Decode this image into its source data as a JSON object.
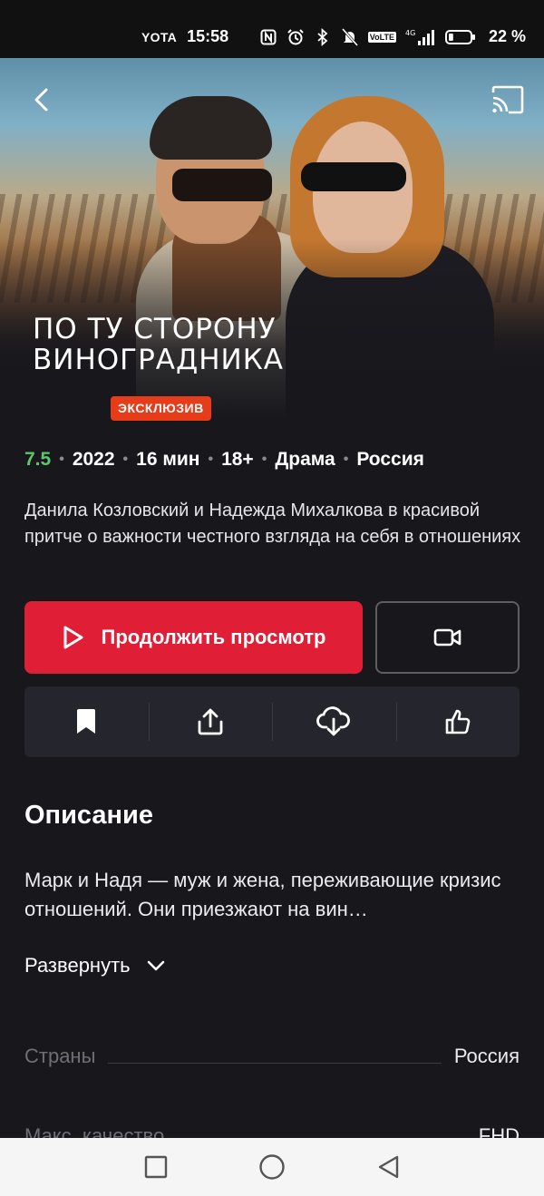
{
  "status_bar": {
    "carrier": "YOTA",
    "time": "15:58",
    "network_badge": "VoLTE",
    "signal_label": "4G",
    "battery_percent": "22 %",
    "battery_level": 0.22
  },
  "hero": {
    "title_line1": "ПО ТУ СТОРОНУ",
    "title_line2": "ВИНОГРАДНИКА",
    "badge": "ЭКСКЛЮЗИВ",
    "badge_color": "#e73c19"
  },
  "meta": {
    "rating": "7.5",
    "rating_color": "#5ec76b",
    "year": "2022",
    "duration": "16 мин",
    "age": "18+",
    "genre": "Драма",
    "country": "Россия"
  },
  "tagline": "Данила Козловский и Надежда Михалкова в красивой притче о важности честного взгляда на себя в отношениях",
  "actions": {
    "play_label": "Продолжить просмотр",
    "play_color": "#e01e36",
    "trailer_icon": "video-camera-icon",
    "quick": [
      "bookmark-icon",
      "share-icon",
      "download-icon",
      "like-icon"
    ]
  },
  "description": {
    "heading": "Описание",
    "text": "Марк и Надя — муж и жена, переживающие кризис отношений. Они приезжают на вин…",
    "expand_label": "Развернуть"
  },
  "info": [
    {
      "key": "Страны",
      "value": "Россия"
    },
    {
      "key": "Макс. качество",
      "value": "FHD"
    }
  ],
  "navigation": [
    "recents-square-icon",
    "home-circle-icon",
    "back-triangle-icon"
  ]
}
